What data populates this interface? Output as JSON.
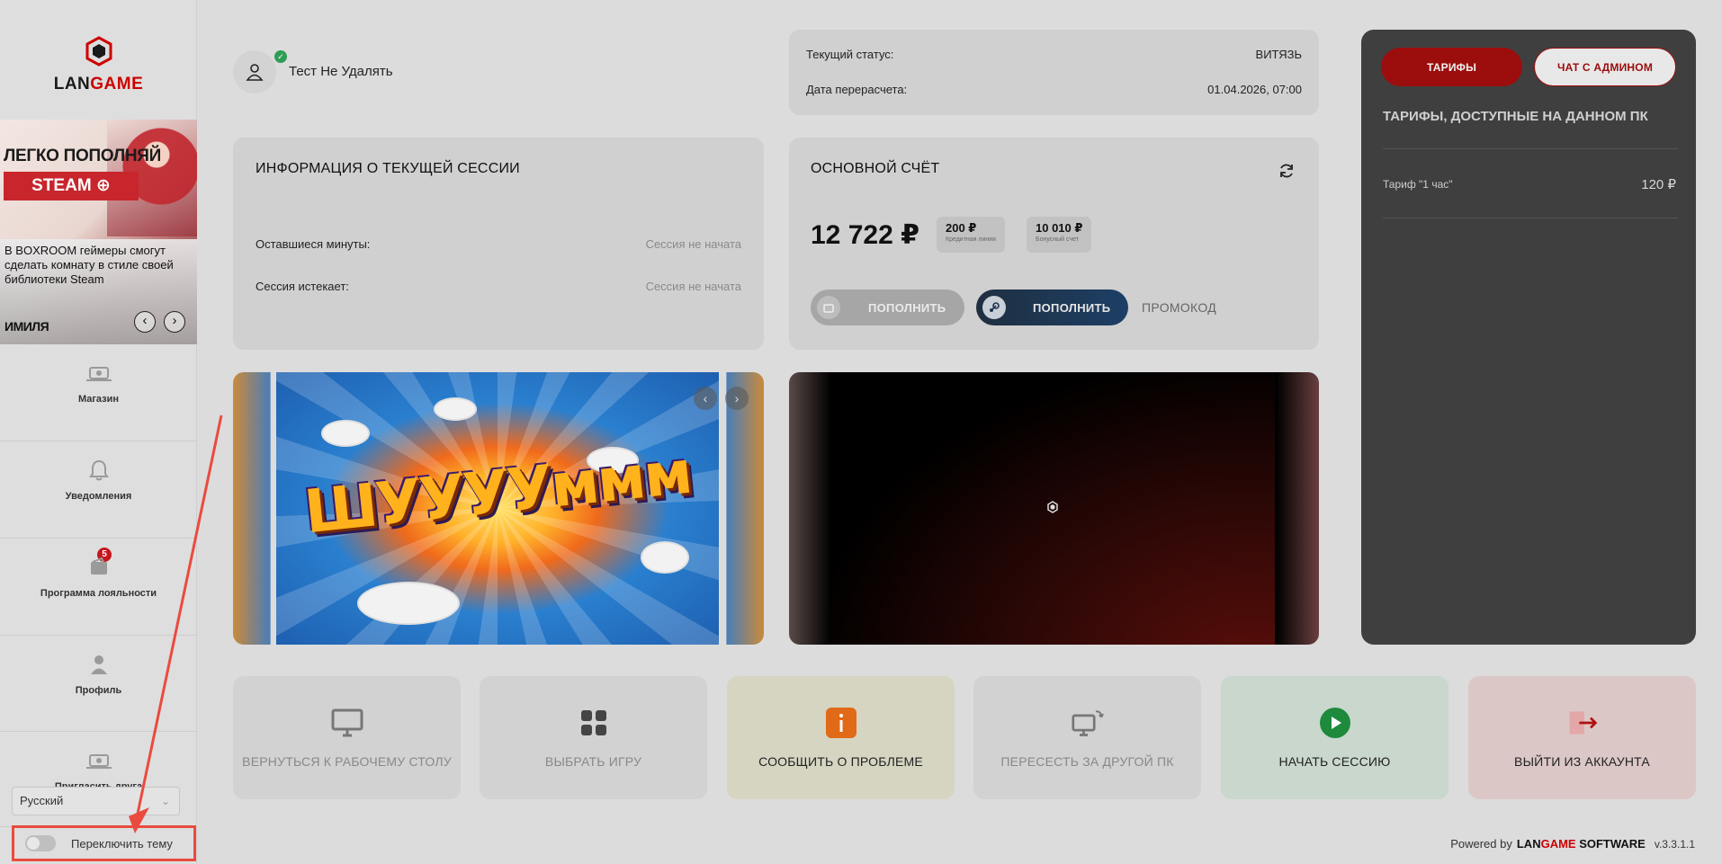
{
  "logo": {
    "text_main": "LAN",
    "text_accent": "GAME"
  },
  "promo": {
    "title_line1": "ЛЕГКО ПОПОЛНЯЙ",
    "title_line2": "STEAM ⊕",
    "caption": "В BOXROOM геймеры смогут сделать комнату в стиле своей библиотеки Steam",
    "brand": "ИМИЛЯ",
    "prev": "‹",
    "next": "›"
  },
  "sidebar": {
    "items": [
      {
        "label": "Магазин",
        "icon": "shop-icon"
      },
      {
        "label": "Уведомления",
        "icon": "bell-icon",
        "badge": "5"
      },
      {
        "label": "Программа лояльности",
        "icon": "wallet-icon"
      },
      {
        "label": "Профиль",
        "icon": "user-icon"
      },
      {
        "label": "Пригласить друга",
        "icon": "invite-icon"
      }
    ],
    "language": "Русский",
    "theme_toggle_label": "Переключить тему"
  },
  "user": {
    "name": "Тест Не Удалять"
  },
  "status": {
    "current_label": "Текущий статус:",
    "current_value": "ВИТЯЗЬ",
    "recalc_label": "Дата перерасчета:",
    "recalc_value": "01.04.2026, 07:00"
  },
  "session": {
    "title": "ИНФОРМАЦИЯ О ТЕКУЩЕЙ СЕССИИ",
    "minutes_label": "Оставшиеся минуты:",
    "minutes_value": "Сессия не начата",
    "expires_label": "Сессия истекает:",
    "expires_value": "Сессия не начата"
  },
  "balance": {
    "title": "ОСНОВНОЙ СЧЁТ",
    "amount": "12 722 ₽",
    "credit_value": "200 ₽",
    "credit_label": "Кредитная линия",
    "bonus_value": "10 010 ₽",
    "bonus_label": "Бонусный счет",
    "topup_label": "ПОПОЛНИТЬ",
    "steam_topup_label": "ПОПОЛНИТЬ",
    "promo_label": "ПРОМОКОД"
  },
  "banner": {
    "word": "ШУУУУммм",
    "prev": "‹",
    "next": "›"
  },
  "tariffs": {
    "btn_tariffs": "ТАРИФЫ",
    "btn_chat": "ЧАТ С АДМИНОМ",
    "title": "ТАРИФЫ, ДОСТУПНЫЕ НА ДАННОМ ПК",
    "items": [
      {
        "name": "Тариф \"1 час\"",
        "price": "120 ₽"
      }
    ]
  },
  "actions": [
    {
      "label": "ВЕРНУТЬСЯ К РАБОЧЕМУ СТОЛУ",
      "icon": "monitor-icon"
    },
    {
      "label": "ВЫБРАТЬ ИГРУ",
      "icon": "grid-icon"
    },
    {
      "label": "СООБЩИТЬ О ПРОБЛЕМЕ",
      "icon": "info-icon"
    },
    {
      "label": "ПЕРЕСЕСТЬ ЗА ДРУГОЙ ПК",
      "icon": "switch-pc-icon"
    },
    {
      "label": "НАЧАТЬ СЕССИЮ",
      "icon": "play-icon"
    },
    {
      "label": "ВЫЙТИ ИЗ АККАУНТА",
      "icon": "logout-icon"
    }
  ],
  "footer": {
    "powered": "Powered by",
    "brand_main": "LAN",
    "brand_accent": "GAME",
    "brand_suffix": " SOFTWARE",
    "version": "v.3.3.1.1"
  },
  "colors": {
    "accent": "#c00000",
    "highlight": "#ea4b3f",
    "panel": "#3f3f3f"
  }
}
